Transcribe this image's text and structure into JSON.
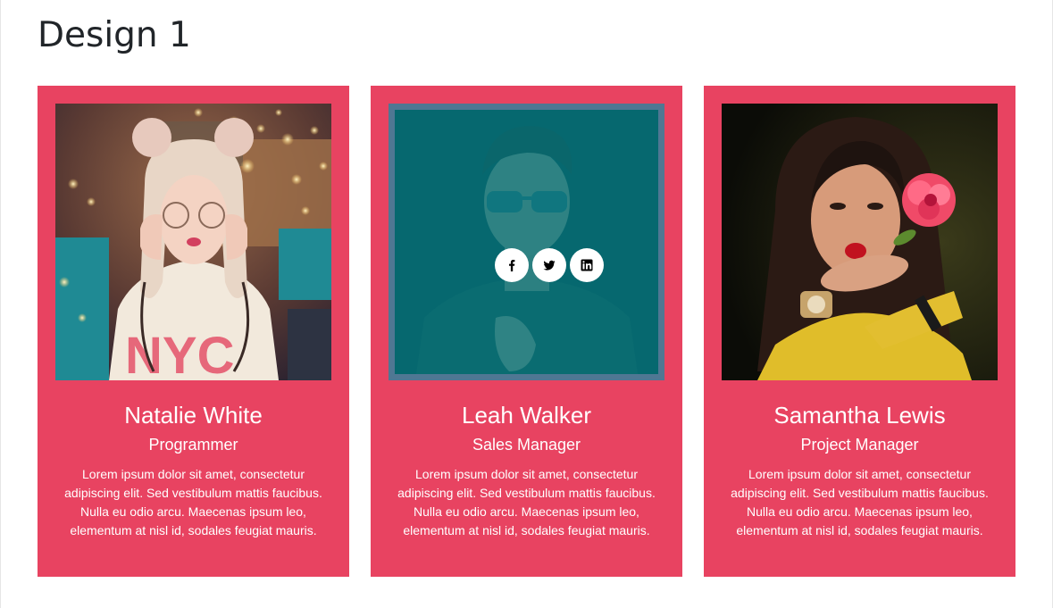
{
  "page": {
    "title": "Design 1"
  },
  "theme": {
    "card_bg": "#e84361",
    "overlay": "#007880",
    "overlay_border": "#4f7793",
    "text": "#ffffff"
  },
  "cards": [
    {
      "name": "Natalie White",
      "role": "Programmer",
      "text": "Lorem ipsum dolor sit amet, consectetur adipiscing elit. Sed vestibulum mattis faucibus. Nulla eu odio arcu. Maecenas ipsum leo, elementum at nisl id, sodales feugiat mauris.",
      "photo": "portrait-woman-glasses"
    },
    {
      "name": "Leah Walker",
      "role": "Sales Manager",
      "text": "Lorem ipsum dolor sit amet, consectetur adipiscing elit. Sed vestibulum mattis faucibus. Nulla eu odio arcu. Maecenas ipsum leo, elementum at nisl id, sodales feugiat mauris.",
      "photo": "portrait-man-sunglasses",
      "social": [
        "facebook-icon",
        "twitter-icon",
        "linkedin-icon"
      ]
    },
    {
      "name": "Samantha Lewis",
      "role": "Project Manager",
      "text": "Lorem ipsum dolor sit amet, consectetur adipiscing elit. Sed vestibulum mattis faucibus. Nulla eu odio arcu. Maecenas ipsum leo, elementum at nisl id, sodales feugiat mauris.",
      "photo": "portrait-woman-flower"
    }
  ]
}
